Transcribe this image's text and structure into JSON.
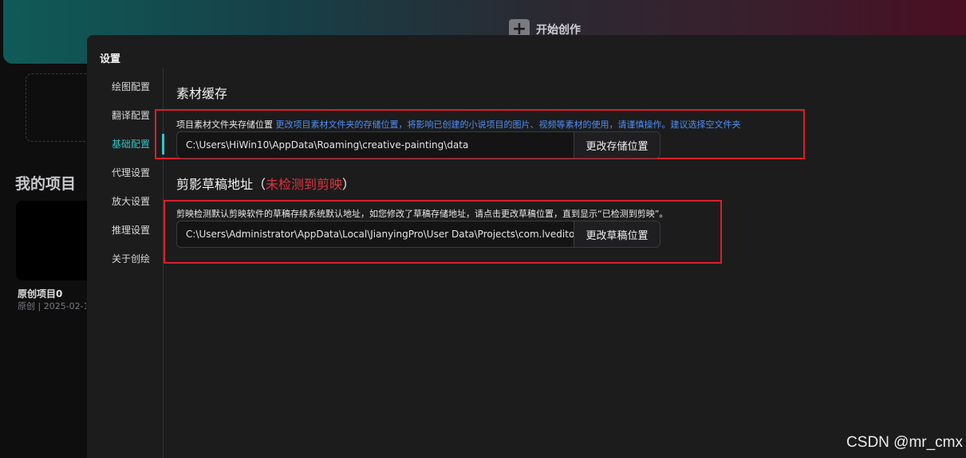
{
  "background": {
    "start_button_label": "开始创作",
    "my_projects_title": "我的项目",
    "project": {
      "name": "原创项目0",
      "meta": "原创 | 2025-02-1"
    }
  },
  "dialog": {
    "title": "设置",
    "nav": [
      {
        "label": "绘图配置",
        "active": false
      },
      {
        "label": "翻译配置",
        "active": false
      },
      {
        "label": "基础配置",
        "active": true
      },
      {
        "label": "代理设置",
        "active": false
      },
      {
        "label": "放大设置",
        "active": false
      },
      {
        "label": "推理设置",
        "active": false
      },
      {
        "label": "关于创绘",
        "active": false
      }
    ],
    "material_cache": {
      "title": "素材缓存",
      "label": "项目素材文件夹存储位置",
      "note": "更改项目素材文件夹的存储位置，将影响已创建的小说项目的图片、视频等素材的使用，请谨慎操作。建议选择空文件夹",
      "path": "C:\\Users\\HiWin10\\AppData\\Roaming\\creative-painting\\data",
      "button": "更改存储位置"
    },
    "draft": {
      "title": "剪影草稿地址",
      "status_open": "（",
      "status": "未检测到剪映",
      "status_close": "）",
      "note": "剪映检测默认剪映软件的草稿存续系统默认地址，如您修改了草稿存储地址，请点击更改草稿位置，直到显示“已检测到剪映”。",
      "path": "C:\\Users\\Administrator\\AppData\\Local\\JianyingPro\\User Data\\Projects\\com.lveditor.draft",
      "button": "更改草稿位置"
    }
  },
  "watermark": "CSDN @mr_cmx",
  "colors": {
    "accent": "#35c4c6",
    "link": "#4d8ff5",
    "warning": "#e0333d",
    "highlight_box": "#d9202c"
  }
}
